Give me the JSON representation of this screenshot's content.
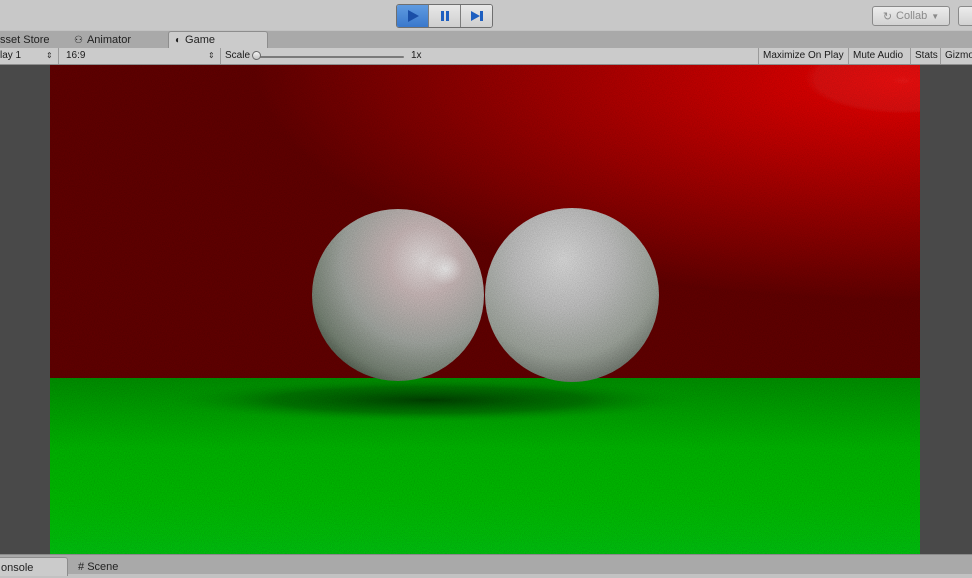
{
  "toolbar": {
    "play_icon": "play-icon",
    "pause_icon": "pause-icon",
    "step_icon": "step-icon",
    "collab_label": "Collab",
    "accent_color": "#3a78cc"
  },
  "tabs": [
    {
      "label": "Asset Store",
      "visible_label": "sset Store"
    },
    {
      "label": "Animator"
    },
    {
      "label": "Game",
      "active": true
    }
  ],
  "game_toolbar": {
    "display_value": "lay 1",
    "aspect_value": "16:9",
    "scale_label": "Scale",
    "scale_value": "1x",
    "maximize_label": "Maximize On Play",
    "mute_label": "Mute Audio",
    "stats_label": "Stats",
    "gizmos_label": "Gizmo"
  },
  "scene": {
    "wall_color": "#b00000",
    "floor_color": "#0fcc10",
    "sphere_color": "#d9d9d9"
  },
  "bottom_tabs": [
    {
      "label": "onsole"
    },
    {
      "label": "Scene"
    }
  ]
}
